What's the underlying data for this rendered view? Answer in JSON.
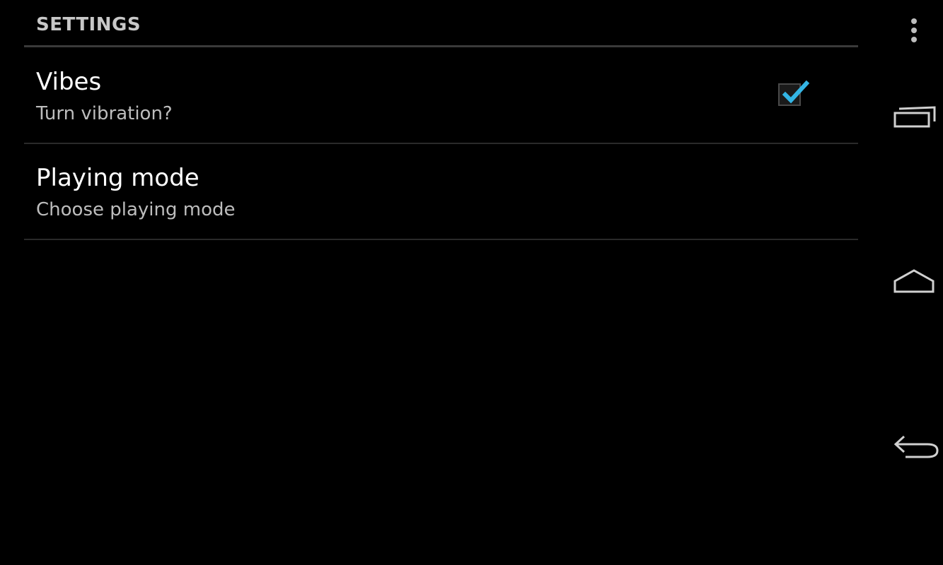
{
  "settings": {
    "category_title": "SETTINGS",
    "preferences": [
      {
        "title": "Vibes",
        "summary": "Turn vibration?",
        "checked": true
      },
      {
        "title": "Playing mode",
        "summary": "Choose playing mode"
      }
    ]
  },
  "navigation_bar": {
    "buttons": [
      "overflow-menu-icon",
      "recent-apps-icon",
      "home-icon",
      "back-icon"
    ]
  },
  "colors": {
    "background": "#000000",
    "checkbox_accent": "#33b5e5",
    "divider": "#2a2a2a"
  }
}
